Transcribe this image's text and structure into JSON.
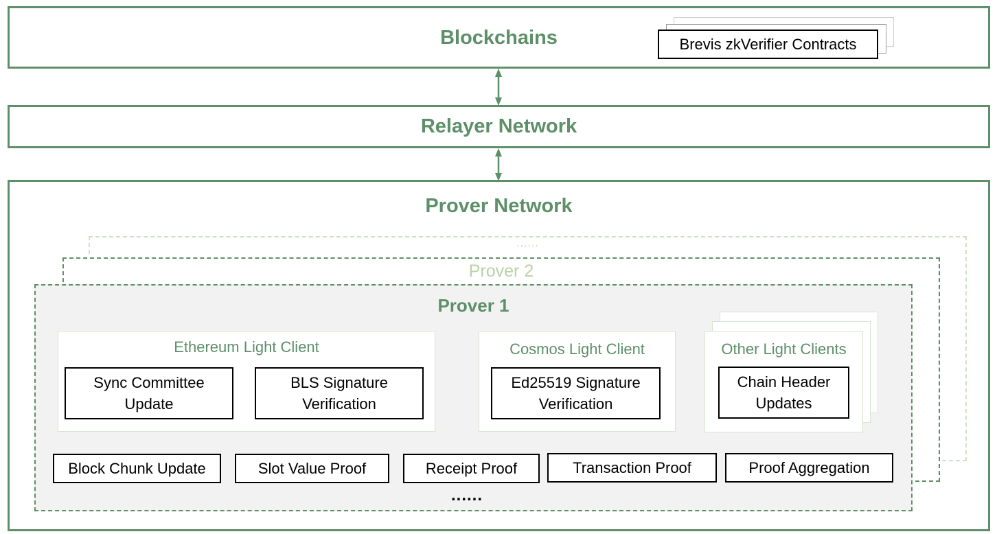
{
  "colors": {
    "accent": "#5d8f68",
    "light_accent": "#b9d2a8",
    "box_border": "#000000",
    "prover_bg": "#f2f2f2"
  },
  "blockchains": {
    "title": "Blockchains",
    "contracts_label": "Brevis zkVerifier Contracts"
  },
  "relayer": {
    "title": "Relayer Network"
  },
  "prover_network": {
    "title": "Prover Network",
    "more_provers": "......",
    "prover2_title": "Prover 2",
    "prover1": {
      "title": "Prover 1",
      "clients": [
        {
          "title": "Ethereum Light Client",
          "items": [
            "Sync Committee\nUpdate",
            "BLS Signature\nVerification"
          ]
        },
        {
          "title": "Cosmos Light Client",
          "items": [
            "Ed25519 Signature\nVerification"
          ]
        },
        {
          "title": "Other Light Clients",
          "items": [
            "Chain Header\nUpdates"
          ]
        }
      ],
      "modules": [
        "Block Chunk Update",
        "Slot Value Proof",
        "Receipt Proof",
        "Transaction Proof",
        "Proof Aggregation"
      ],
      "more_modules": "......"
    }
  }
}
